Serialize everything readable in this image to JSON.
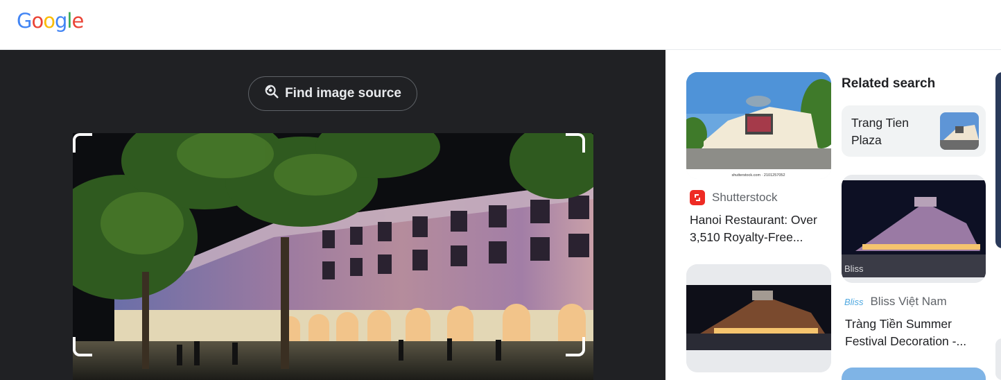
{
  "header": {
    "logo_letters": [
      "G",
      "o",
      "o",
      "g",
      "l",
      "e"
    ],
    "logo_colors": [
      "#4285F4",
      "#EA4335",
      "#FBBC05",
      "#4285F4",
      "#34A853",
      "#EA4335"
    ]
  },
  "lens": {
    "find_source_label": "Find image source"
  },
  "results": [
    {
      "source": "Shutterstock",
      "title_line1": "Hanoi Restaurant: Over",
      "title_line2": "3,510 Royalty-Free...",
      "watermark": "shutterstock.com · 2101257052"
    },
    {
      "source": "Bliss Việt Nam",
      "logo_text": "Bliss",
      "title_line1": "Tràng Tiền Summer",
      "title_line2": "Festival Decoration -...",
      "watermark": "Bliss"
    }
  ],
  "related": {
    "heading": "Related search",
    "chips": [
      {
        "line1": "Trang Tien",
        "line2": "Plaza"
      }
    ]
  },
  "colors": {
    "dark_bg": "#202124",
    "shutterstock_red": "#EE2B24",
    "bliss_blue": "#4FA8E0"
  }
}
